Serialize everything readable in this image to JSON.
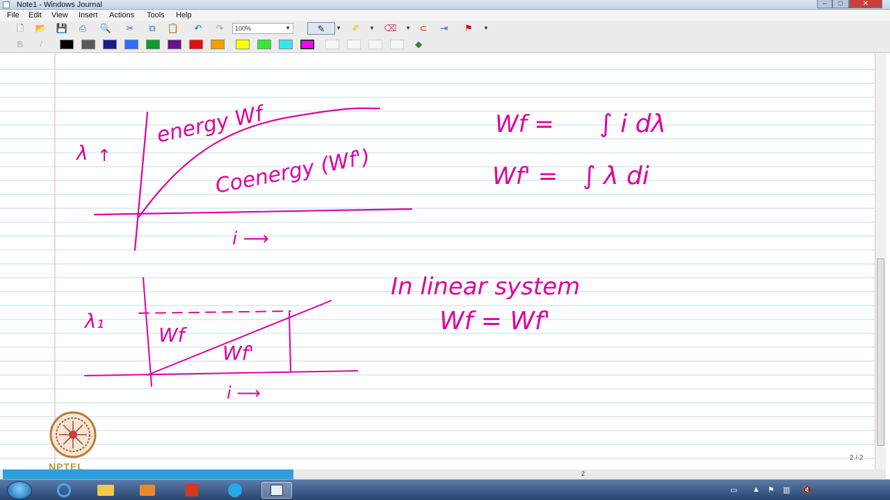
{
  "window": {
    "title": "Note1 - Windows Journal"
  },
  "menu": [
    "File",
    "Edit",
    "View",
    "Insert",
    "Actions",
    "Tools",
    "Help"
  ],
  "toolbar": {
    "zoom": "100%"
  },
  "pen_colors": [
    "#000000",
    "#5a5a5a",
    "#1b1b86",
    "#2f6cff",
    "#0f9a2c",
    "#6a1288",
    "#e01010",
    "#f0a000",
    "#ffff00",
    "#3ce33c",
    "#39e6ea",
    "#ff00ff"
  ],
  "accent_color": "#e000a0",
  "notes": {
    "graph1": {
      "y_axis_label": "λ",
      "x_axis_label": "i ⟶",
      "energy_label": "energy Wf",
      "coenergy_label": "Coenergy (Wf')"
    },
    "eq1_lhs": "Wf =",
    "eq1_rhs": "∫ i dλ",
    "eq2_lhs": "Wf' =",
    "eq2_rhs": "∫ λ di",
    "graph2": {
      "y_label": "λ₁",
      "x_axis_label": "i ⟶",
      "upper_region": "Wf",
      "lower_region": "Wf'"
    },
    "linear_heading": "In linear system",
    "linear_equation": "Wf = Wf'"
  },
  "logo": {
    "text": "NPTEL"
  },
  "page_indicator": "2 / 2",
  "status_page": "2"
}
